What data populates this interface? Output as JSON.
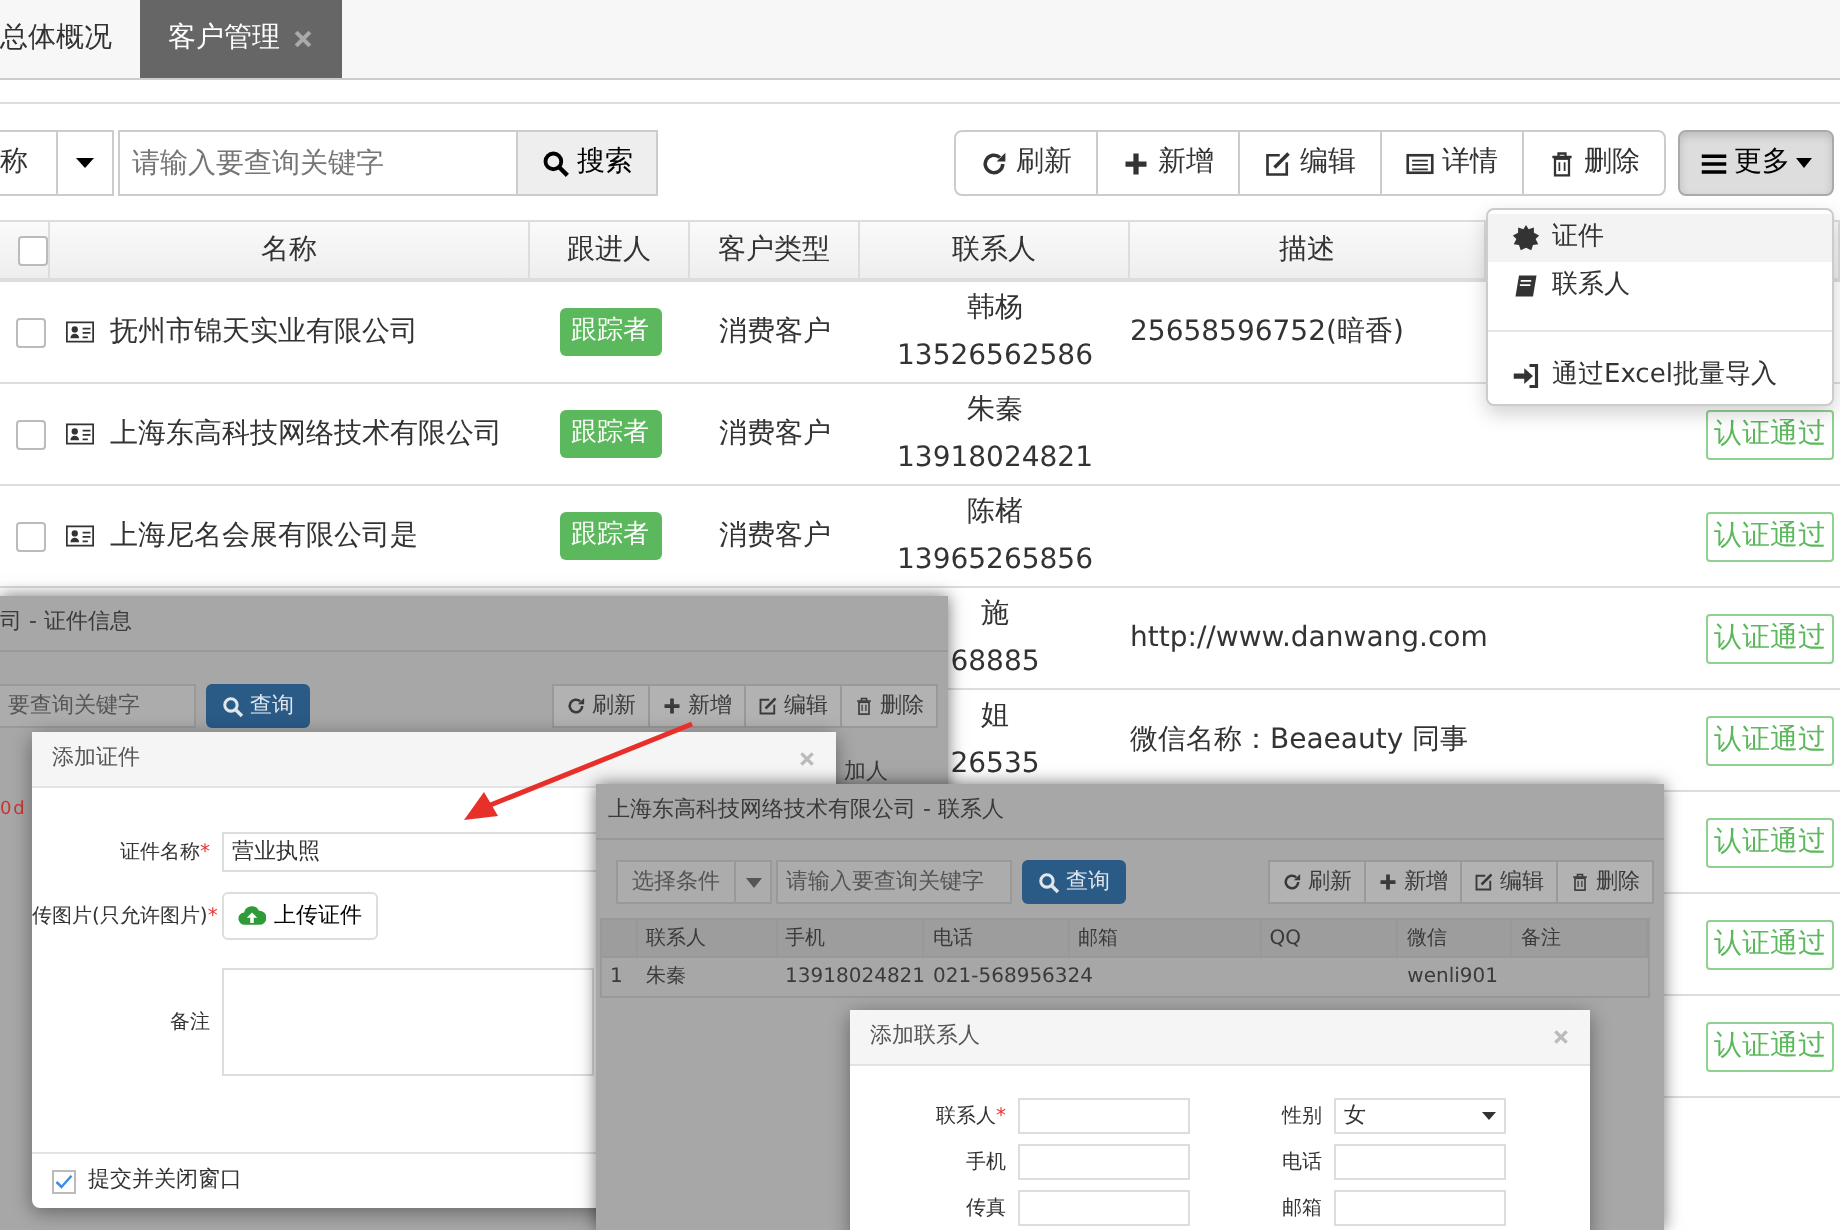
{
  "tabs": [
    {
      "label": "总体概况",
      "selected": false,
      "closable": false
    },
    {
      "label": "客户管理",
      "selected": true,
      "closable": true
    }
  ],
  "toolbar": {
    "filter": "称",
    "search_placeholder": "请输入要查询关键字",
    "search_button": "搜索",
    "buttons": [
      {
        "kind": "refresh",
        "label": "刷新"
      },
      {
        "kind": "add",
        "label": "新增"
      },
      {
        "kind": "edit",
        "label": "编辑"
      },
      {
        "kind": "details",
        "label": "详情"
      },
      {
        "kind": "delete",
        "label": "删除"
      }
    ],
    "more": {
      "label": "更多",
      "expanded": true
    }
  },
  "more_menu": {
    "groups": [
      [
        {
          "kind": "gear",
          "label": "证件",
          "selected": true
        },
        {
          "kind": "book",
          "label": "联系人",
          "selected": false
        }
      ],
      [
        {
          "kind": "import",
          "label": "通过Excel批量导入",
          "selected": false
        }
      ]
    ]
  },
  "table": {
    "header_checked": false,
    "columns": [
      "名称",
      "跟进人",
      "客户类型",
      "联系人",
      "描述"
    ],
    "rows": [
      {
        "checked": false,
        "name": "抚州市锦天实业有限公司",
        "follower": "跟踪者",
        "type": "消费客户",
        "contact": "韩杨",
        "phone": "13526562586",
        "description": "25658596752(暗香)"
      },
      {
        "checked": false,
        "name": "上海东高科技网络技术有限公司",
        "follower": "跟踪者",
        "type": "消费客户",
        "contact": "朱秦",
        "phone": "13918024821",
        "status": "认证通过"
      },
      {
        "checked": false,
        "name": "上海尼名会展有限公司是",
        "follower": "跟踪者",
        "type": "消费客户",
        "contact": "陈楮",
        "phone": "13965265856",
        "status": "认证通过"
      },
      {
        "contact": "施",
        "phone": "68885",
        "description": "http://www.danwang.com",
        "status": "认证通过"
      },
      {
        "contact": "姐",
        "phone": "26535",
        "description": "微信名称：Beaeauty 同事",
        "status": "认证通过"
      },
      {
        "status": "认证通过"
      },
      {
        "status": "认证通过"
      },
      {
        "status": "认证通过"
      }
    ]
  },
  "cert_window": {
    "title": "司 - 证件信息",
    "search_placeholder": "要查询关键字",
    "search_button": "查询",
    "buttons": [
      {
        "kind": "refresh",
        "label": "刷新"
      },
      {
        "kind": "add",
        "label": "新增"
      },
      {
        "kind": "edit",
        "label": "编辑"
      },
      {
        "kind": "delete",
        "label": "删除"
      }
    ],
    "header_fragment": "加人",
    "error_fragment": "0 d",
    "dialog": {
      "title": "添加证件",
      "fields": [
        {
          "kind": "text",
          "label": "证件名称",
          "mark": "*",
          "value": "营业执照"
        },
        {
          "kind": "upload",
          "label": "传图片(只允许图片)",
          "mark": "*",
          "button": "上传证件"
        },
        {
          "kind": "textarea",
          "label": "备注"
        }
      ],
      "footer": {
        "label": "提交并关闭窗口",
        "checked": true
      }
    }
  },
  "contacts_window": {
    "title": "上海东高科技网络技术有限公司 - 联系人",
    "filter": "选择条件",
    "search_placeholder": "请输入要查询关键字",
    "search_button": "查询",
    "buttons": [
      {
        "kind": "refresh",
        "label": "刷新"
      },
      {
        "kind": "add",
        "label": "新增"
      },
      {
        "kind": "edit",
        "label": "编辑"
      },
      {
        "kind": "delete",
        "label": "删除"
      }
    ],
    "columns": [
      "联系人",
      "手机",
      "电话",
      "邮箱",
      "QQ",
      "微信",
      "备注"
    ],
    "rows": [
      {
        "index": "1",
        "cells": [
          "朱秦",
          "13918024821",
          "021-568956324",
          null,
          null,
          "wenli901",
          null
        ]
      }
    ],
    "dialog": {
      "title": "添加联系人",
      "fields": [
        {
          "kind": "text",
          "label": "联系人",
          "mark": "*"
        },
        {
          "kind": "select",
          "label": "性别",
          "value": "女"
        },
        {
          "kind": "text",
          "label": "手机"
        },
        {
          "kind": "text",
          "label": "电话"
        },
        {
          "kind": "text",
          "label": "传真"
        },
        {
          "kind": "text",
          "label": "邮箱"
        }
      ]
    }
  }
}
